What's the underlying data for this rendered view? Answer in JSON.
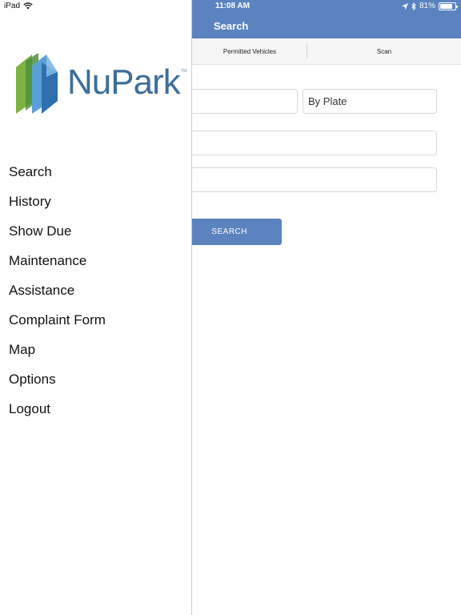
{
  "status_bar": {
    "device": "iPad",
    "time": "11:08 AM",
    "battery": "81%",
    "battery_level": 0.81
  },
  "navbar": {
    "title": "Search"
  },
  "segments": [
    {
      "label": "Permitted Vehicles"
    },
    {
      "label": "Scan"
    }
  ],
  "form": {
    "search_type_value": "By Plate",
    "search_button_label": "SEARCH"
  },
  "drawer": {
    "logo_text": "NuPark",
    "logo_tm": "TM",
    "menu": [
      {
        "label": "Search"
      },
      {
        "label": "History"
      },
      {
        "label": "Show Due"
      },
      {
        "label": "Maintenance"
      },
      {
        "label": "Assistance"
      },
      {
        "label": "Complaint Form"
      },
      {
        "label": "Map"
      },
      {
        "label": "Options"
      },
      {
        "label": "Logout"
      }
    ]
  },
  "colors": {
    "nav_blue": "#5b83bf",
    "logo_blue": "#3e6e9a",
    "logo_green": "#7cb342"
  }
}
